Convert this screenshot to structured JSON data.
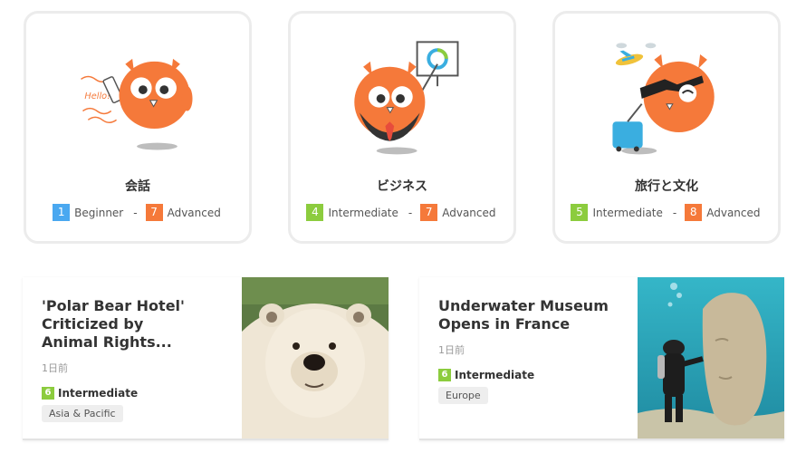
{
  "courses": [
    {
      "title": "会話",
      "hello_text": "Hello!",
      "from": {
        "num": "1",
        "label": "Beginner",
        "color": "#4aa8f0"
      },
      "to": {
        "num": "7",
        "label": "Advanced",
        "color": "#f5793a"
      }
    },
    {
      "title": "ビジネス",
      "from": {
        "num": "4",
        "label": "Intermediate",
        "color": "#8ccc3e"
      },
      "to": {
        "num": "7",
        "label": "Advanced",
        "color": "#f5793a"
      }
    },
    {
      "title": "旅行と文化",
      "from": {
        "num": "5",
        "label": "Intermediate",
        "color": "#8ccc3e"
      },
      "to": {
        "num": "8",
        "label": "Advanced",
        "color": "#f5793a"
      }
    }
  ],
  "separator": "-",
  "news": [
    {
      "title": "'Polar Bear Hotel' Criticized by Animal Rights...",
      "time": "1日前",
      "level_num": "6",
      "level_label": "Intermediate",
      "level_color": "#8ccc3e",
      "region": "Asia & Pacific"
    },
    {
      "title": "Underwater Museum Opens in France",
      "time": "1日前",
      "level_num": "6",
      "level_label": "Intermediate",
      "level_color": "#8ccc3e",
      "region": "Europe"
    }
  ]
}
